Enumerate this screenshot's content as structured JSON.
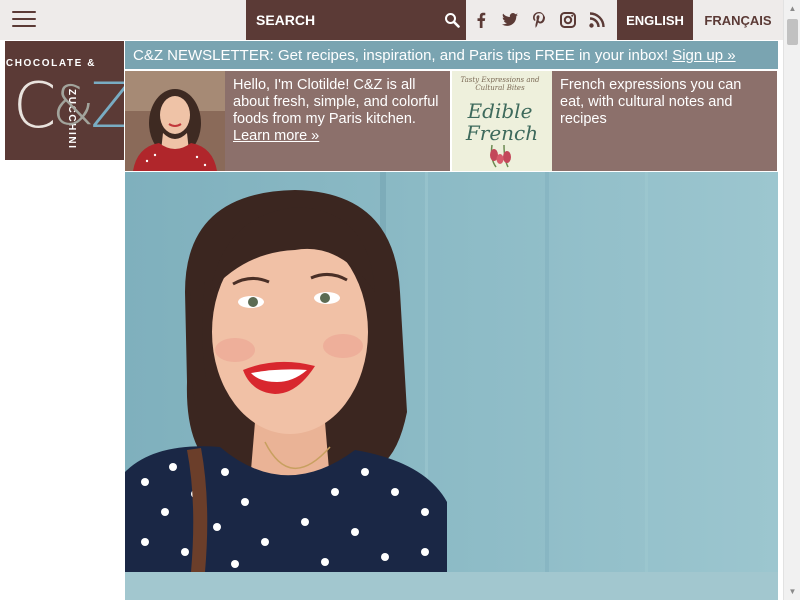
{
  "header": {
    "search": {
      "placeholder": "SEARCH",
      "icon": "search-icon"
    },
    "social": [
      {
        "name": "facebook-icon"
      },
      {
        "name": "twitter-icon"
      },
      {
        "name": "pinterest-icon"
      },
      {
        "name": "instagram-icon"
      },
      {
        "name": "rss-icon"
      }
    ],
    "languages": {
      "english": "ENGLISH",
      "french": "FRANÇAIS"
    }
  },
  "logo": {
    "word_top": "CHOCOLATE &",
    "word_side": "ZUCCHINI",
    "monogram_c": "C",
    "monogram_amp": "&",
    "monogram_z": "Z"
  },
  "newsletter": {
    "text": "C&Z NEWSLETTER: Get recipes, inspiration, and Paris tips FREE in your inbox!",
    "link": "Sign up »"
  },
  "promo": {
    "about": {
      "text": "Hello, I'm Clotilde! C&Z is all about fresh, simple, and colorful foods from my Paris kitchen.",
      "link": "Learn more »"
    },
    "french": {
      "text": "French expressions you can eat, with cultural notes and recipes",
      "book_tagline": "Tasty Expressions and Cultural Bites",
      "book_title_1": "Edible",
      "book_title_2": "French"
    }
  },
  "colors": {
    "brand_brown": "#5b3a36",
    "promo_mauve": "#8c706b",
    "newsletter_blue": "#7aa4b1",
    "background_light": "#eeebea",
    "hero_teal": "#8fb9c3",
    "logo_c": "#e9e3de",
    "logo_amp": "#a2a49c",
    "logo_z": "#79acc3"
  }
}
